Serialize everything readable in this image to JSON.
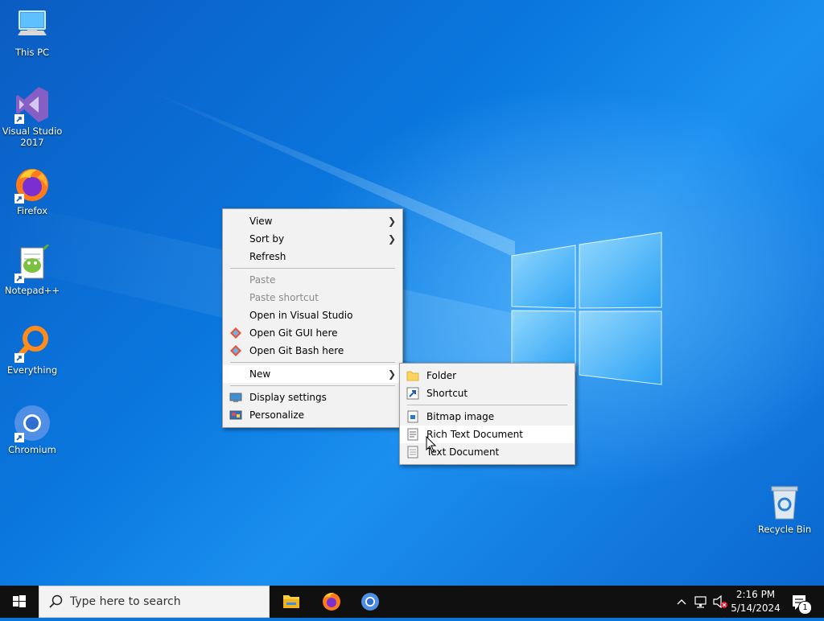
{
  "desktop": {
    "icons": [
      {
        "label": "This PC"
      },
      {
        "label": "Visual Studio 2017"
      },
      {
        "label": "Firefox"
      },
      {
        "label": "Notepad++"
      },
      {
        "label": "Everything"
      },
      {
        "label": "Chromium"
      },
      {
        "label": "Recycle Bin"
      }
    ]
  },
  "context_menu": {
    "items": [
      {
        "label": "View"
      },
      {
        "label": "Sort by"
      },
      {
        "label": "Refresh"
      },
      {
        "label": "Paste"
      },
      {
        "label": "Paste shortcut"
      },
      {
        "label": "Open in Visual Studio"
      },
      {
        "label": "Open Git GUI here"
      },
      {
        "label": "Open Git Bash here"
      },
      {
        "label": "New"
      },
      {
        "label": "Display settings"
      },
      {
        "label": "Personalize"
      }
    ]
  },
  "new_submenu": {
    "items": [
      {
        "label": "Folder"
      },
      {
        "label": "Shortcut"
      },
      {
        "label": "Bitmap image"
      },
      {
        "label": "Rich Text Document"
      },
      {
        "label": "Text Document"
      }
    ]
  },
  "taskbar": {
    "search_placeholder": "Type here to search",
    "time": "2:16 PM",
    "date": "5/14/2024",
    "notification_count": "1"
  },
  "colors": {
    "taskbar": "#101010",
    "menu_bg": "#f2f2f2",
    "desktop_blue": "#0a74da"
  }
}
